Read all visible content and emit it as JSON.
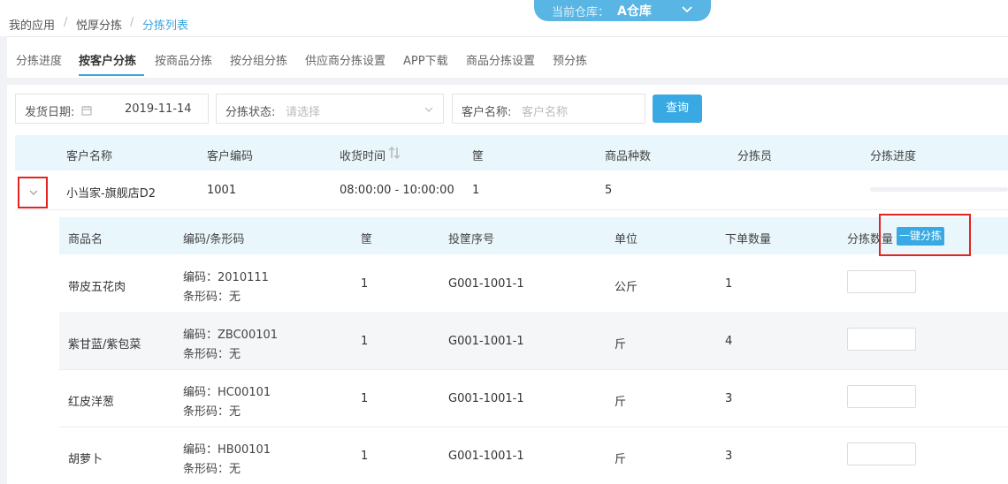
{
  "breadcrumb": {
    "items": [
      "我的应用",
      "悦厚分拣",
      "分拣列表"
    ],
    "separator": "/"
  },
  "warehouse": {
    "label": "当前仓库：",
    "value": "A仓库",
    "icon": "chevron-down-icon"
  },
  "tabs": [
    {
      "label": "分拣进度",
      "active": false
    },
    {
      "label": "按客户分拣",
      "active": true
    },
    {
      "label": "按商品分拣",
      "active": false
    },
    {
      "label": "按分组分拣",
      "active": false
    },
    {
      "label": "供应商分拣设置",
      "active": false
    },
    {
      "label": "APP下载",
      "active": false
    },
    {
      "label": "商品分拣设置",
      "active": false
    },
    {
      "label": "预分拣",
      "active": false
    }
  ],
  "filters": {
    "date_label": "发货日期:",
    "date_value": "2019-11-14",
    "status_label": "分拣状态:",
    "status_placeholder": "请选择",
    "customer_label": "客户名称:",
    "customer_placeholder": "客户名称",
    "query_button": "查询"
  },
  "customer_table": {
    "headers": [
      "客户名称",
      "客户编码",
      "收货时间",
      "筐",
      "商品种数",
      "分拣员",
      "分拣进度"
    ],
    "row": {
      "name": "小当家-旗舰店D2",
      "code": "1001",
      "time": "08:00:00 - 10:00:00",
      "basket": "1",
      "kinds": "5",
      "sorter": "",
      "progress": 0
    }
  },
  "item_table": {
    "headers": [
      "商品名",
      "编码/条形码",
      "筐",
      "投筐序号",
      "单位",
      "下单数量",
      "分拣数量"
    ],
    "one_click_button": "一键分拣",
    "rows": [
      {
        "name": "带皮五花肉",
        "code": "编码：2010111",
        "barcode": "条形码：无",
        "basket": "1",
        "seq": "G001-1001-1",
        "unit": "公斤",
        "qty": "1"
      },
      {
        "name": "紫甘蓝/紫包菜",
        "code": "编码：ZBC00101",
        "barcode": "条形码：无",
        "basket": "1",
        "seq": "G001-1001-1",
        "unit": "斤",
        "qty": "4"
      },
      {
        "name": "红皮洋葱",
        "code": "编码：HC00101",
        "barcode": "条形码：无",
        "basket": "1",
        "seq": "G001-1001-1",
        "unit": "斤",
        "qty": "3"
      },
      {
        "name": "胡萝卜",
        "code": "编码：HB00101",
        "barcode": "条形码：无",
        "basket": "1",
        "seq": "G001-1001-1",
        "unit": "斤",
        "qty": "3"
      }
    ]
  },
  "colors": {
    "accent": "#39a9e3",
    "highlight": "#e3241f",
    "header_bg": "#e9f6fc"
  }
}
